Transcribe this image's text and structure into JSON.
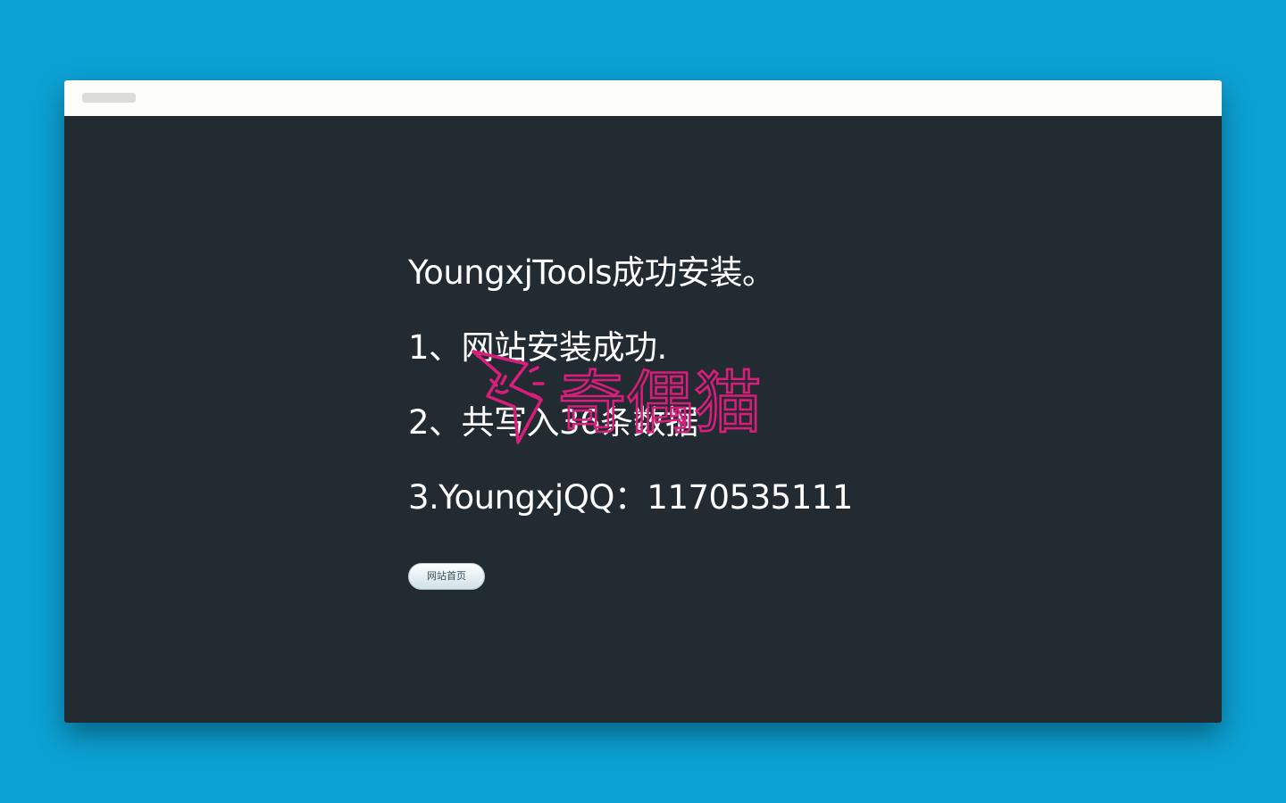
{
  "page": {
    "lines": [
      "YoungxjTools成功安装。",
      "1、网站安装成功.",
      "2、共写入36条数据",
      "3.YoungxjQQ：1170535111"
    ],
    "home_button_label": "网站首页"
  },
  "watermark": {
    "text": "奇偶猫",
    "color": "#d81e7a"
  },
  "colors": {
    "page_background": "#0ca1d4",
    "window_background": "#222b32",
    "titlebar_background": "#fdfdf9",
    "text": "#ffffff"
  }
}
